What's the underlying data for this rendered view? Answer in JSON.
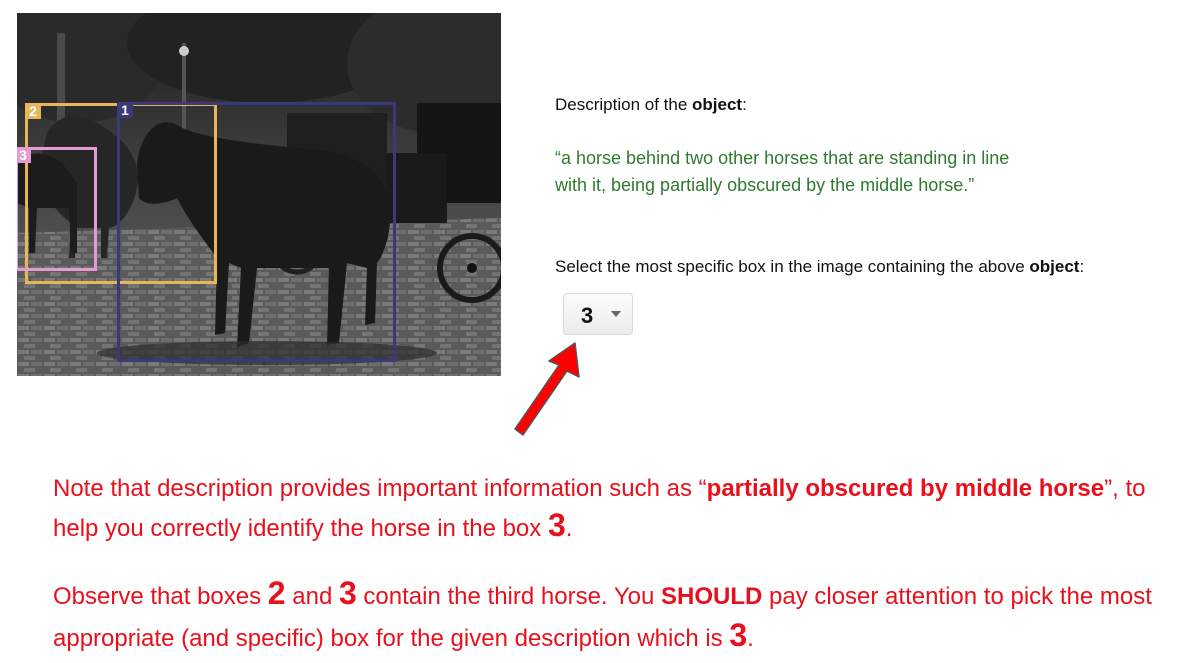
{
  "image": {
    "description": "Grayscale photo of horses with carriages on a cobblestone street",
    "boxes": [
      {
        "number": "2",
        "color": "#e8b65a"
      },
      {
        "number": "1",
        "color": "#3a3a7a"
      },
      {
        "number": "3",
        "color": "#e29bd4"
      }
    ]
  },
  "description_section": {
    "label_prefix": "Description of the ",
    "label_bold": "object",
    "label_suffix": ":",
    "quote_line1": "“a horse behind two other horses that are standing in line",
    "quote_line2": "with it, being partially obscured by the middle horse.”"
  },
  "selection": {
    "label_prefix": "Select the most specific box in the image containing the above ",
    "label_bold": "object",
    "label_suffix": ":",
    "selected_value": "3"
  },
  "notes": {
    "p1_a": "Note that description provides important information such as “",
    "p1_b": "partially obscured by middle horse",
    "p1_c": "”, to help you correctly identify the horse in the box ",
    "p1_d": "3",
    "p1_e": ".",
    "p2_a": "Observe that boxes ",
    "p2_b": "2",
    "p2_c": " and ",
    "p2_d": "3",
    "p2_e": " contain the third horse. You ",
    "p2_f": "SHOULD",
    "p2_g": " pay closer attention to pick the most appropriate (and specific) box for the given description which is ",
    "p2_h": "3",
    "p2_i": "."
  },
  "colors": {
    "note_red": "#e8101c",
    "quote_green": "#2f7a2f",
    "arrow_red": "#ff0000"
  }
}
